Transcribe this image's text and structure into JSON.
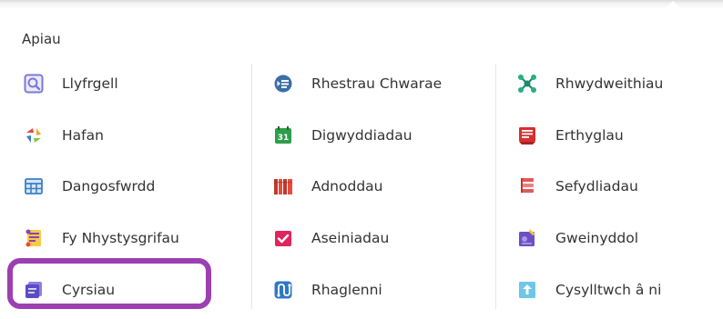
{
  "menu": {
    "section_title": "Apiau",
    "columns": [
      {
        "items": [
          {
            "label": "Llyfrgell",
            "icon": "library-search-icon"
          },
          {
            "label": "Hafan",
            "icon": "home-pinwheel-icon"
          },
          {
            "label": "Dangosfwrdd",
            "icon": "dashboard-grid-icon"
          },
          {
            "label": "Fy Nhystysgrifau",
            "icon": "certificates-icon"
          },
          {
            "label": "Cyrsiau",
            "icon": "courses-icon"
          }
        ]
      },
      {
        "items": [
          {
            "label": "Rhestrau Chwarae",
            "icon": "playlists-icon"
          },
          {
            "label": "Digwyddiadau",
            "icon": "events-calendar-icon",
            "icon_text": "31"
          },
          {
            "label": "Adnoddau",
            "icon": "resources-books-icon"
          },
          {
            "label": "Aseiniadau",
            "icon": "assignments-check-icon"
          },
          {
            "label": "Rhaglenni",
            "icon": "programs-path-icon"
          }
        ]
      },
      {
        "items": [
          {
            "label": "Rhwydweithiau",
            "icon": "networks-icon"
          },
          {
            "label": "Erthyglau",
            "icon": "articles-icon"
          },
          {
            "label": "Sefydliadau",
            "icon": "organizations-icon"
          },
          {
            "label": "Gweinyddol",
            "icon": "admin-icon"
          },
          {
            "label": "Cysylltwch â ni",
            "icon": "contact-upload-icon"
          }
        ]
      }
    ]
  },
  "colors": {
    "text": "#333333",
    "highlight": "#9c3fb0",
    "library": "#7b78d6",
    "dashboard": "#3b7fc4",
    "playlists": "#3b6ea5",
    "events": "#2e9e4a",
    "resources": "#c0392b",
    "assignments": "#e0245e",
    "programs": "#2f78c4",
    "networks": "#1f8a70",
    "articles": "#d63031",
    "organizations": "#e05a5a",
    "admin": "#6c4fc4",
    "contact": "#6ec6ea"
  }
}
